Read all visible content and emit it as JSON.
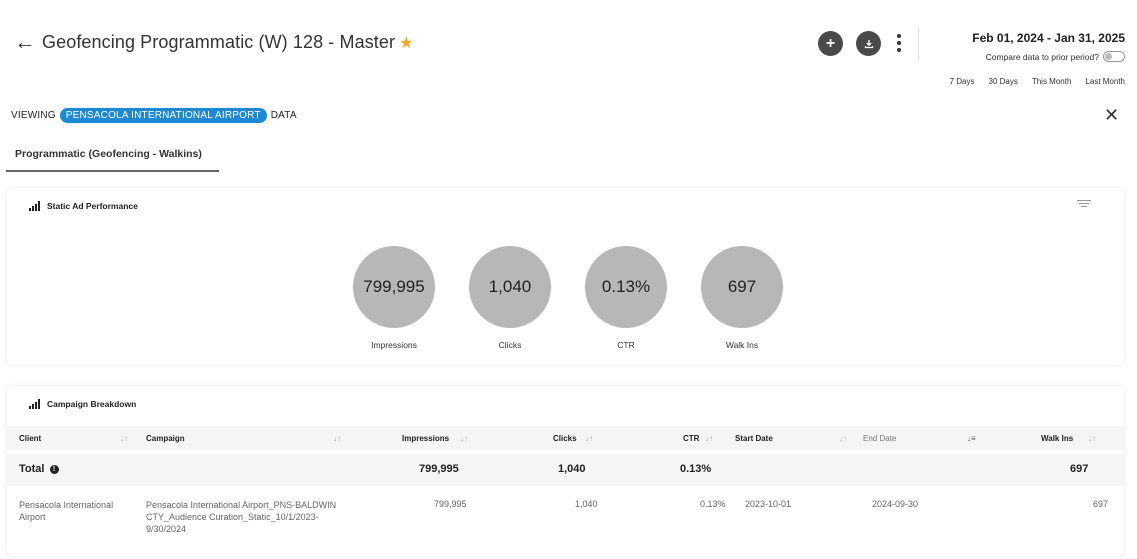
{
  "header": {
    "title": "Geofencing Programmatic (W) 128 - Master",
    "back_icon": "back-arrow-icon",
    "star_icon": "star-icon",
    "add_icon": "plus-icon",
    "download_icon": "download-icon",
    "more_icon": "more-vertical-icon",
    "date_range": "Feb 01, 2024 - Jan 31, 2025",
    "compare_label": "Compare data to prior period?",
    "compare_enabled": false,
    "quick_ranges": [
      "7 Days",
      "30 Days",
      "This Month",
      "Last Month"
    ]
  },
  "viewing": {
    "prefix": "VIEWING",
    "entity": "PENSACOLA INTERNATIONAL AIRPORT",
    "suffix": "DATA"
  },
  "tabs": [
    {
      "label": "Programmatic (Geofencing - Walkins)",
      "active": true
    }
  ],
  "performance": {
    "title": "Static Ad Performance",
    "metrics": [
      {
        "value": "799,995",
        "label": "Impressions"
      },
      {
        "value": "1,040",
        "label": "Clicks"
      },
      {
        "value": "0.13%",
        "label": "CTR"
      },
      {
        "value": "697",
        "label": "Walk Ins"
      }
    ]
  },
  "breakdown": {
    "title": "Campaign Breakdown",
    "columns": [
      "Client",
      "Campaign",
      "Impressions",
      "Clicks",
      "CTR",
      "Start Date",
      "End Date",
      "Walk Ins"
    ],
    "total": {
      "label": "Total",
      "impressions": "799,995",
      "clicks": "1,040",
      "ctr": "0.13%",
      "walk_ins": "697"
    },
    "rows": [
      {
        "client": "Pensacola International Airport",
        "campaign": "Pensacola International Airport_PNS-BALDWIN CTY_Audience Curation_Static_10/1/2023-9/30/2024",
        "impressions": "799,995",
        "clicks": "1,040",
        "ctr": "0.13%",
        "start_date": "2023-10-01",
        "end_date": "2024-09-30",
        "walk_ins": "697"
      }
    ]
  },
  "colors": {
    "accent": "#1d88d4",
    "star": "#f5a623",
    "metric_circle": "#b7b7b7",
    "button_dark": "#4a4a4a"
  }
}
